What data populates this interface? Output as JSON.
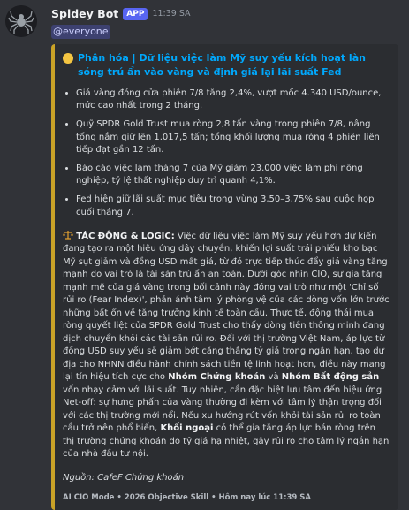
{
  "message": {
    "bot_name": "Spidey Bot",
    "badge": "APP",
    "timestamp": "11:39 SA",
    "mention": "@everyone"
  },
  "colors": {
    "embed_bar": "#c9a227",
    "title": "#00a8fc",
    "mention_bg": "#5865f2"
  },
  "embed": {
    "title_icon": "yellow-circle-icon",
    "title": "Phân hóa | Dữ liệu việc làm Mỹ suy yếu kích hoạt làn sóng trú ẩn vào vàng và định giá lại lãi suất Fed",
    "bullets": [
      "Giá vàng đóng cửa phiên 7/8 tăng 2,4%, vượt mốc 4.340 USD/ounce, mức cao nhất trong 2 tháng.",
      "Quỹ SPDR Gold Trust mua ròng 2,8 tấn vàng trong phiên 7/8, nâng tổng nắm giữ lên 1.017,5 tấn; tổng khối lượng mua ròng 4 phiên liên tiếp đạt gần 12 tấn.",
      "Báo cáo việc làm tháng 7 của Mỹ giảm 23.000 việc làm phi nông nghiệp, tỷ lệ thất nghiệp duy trì quanh 4,1%.",
      "Fed hiện giữ lãi suất mục tiêu trong vùng 3,50–3,75% sau cuộc họp cuối tháng 7."
    ],
    "impact": {
      "icon": "balance-scale-icon",
      "label": "TÁC ĐỘNG & LOGIC:",
      "p1": " Việc dữ liệu việc làm Mỹ suy yếu hơn dự kiến đang tạo ra một hiệu ứng dây chuyền, khiến lợi suất trái phiếu kho bạc Mỹ sụt giảm và đồng USD mất giá, từ đó trực tiếp thúc đẩy giá vàng tăng mạnh do vai trò là tài sản trú ẩn an toàn. Dưới góc nhìn CIO, sự gia tăng mạnh mẽ của giá vàng trong bối cảnh này đóng vai trò như một 'Chỉ số rủi ro (Fear Index)', phản ánh tâm lý phòng vệ của các dòng vốn lớn trước những bất ổn về tăng trưởng kinh tế toàn cầu. Thực tế, động thái mua ròng quyết liệt của SPDR Gold Trust cho thấy dòng tiền thông minh đang dịch chuyển khỏi các tài sản rủi ro. Đối với thị trường Việt Nam, áp lực từ đồng USD suy yếu sẽ giảm bớt căng thẳng tỷ giá trong ngắn hạn, tạo dư địa cho NHNN điều hành chính sách tiền tệ linh hoạt hơn, điều này mang lại tín hiệu tích cực cho ",
      "b1": "Nhóm Chứng khoán",
      "p2": " và ",
      "b2": "Nhóm Bất động sản",
      "p3": " vốn nhạy cảm với lãi suất. Tuy nhiên, cần đặc biệt lưu tâm đến hiệu ứng Net-off: sự hưng phấn của vàng thường đi kèm với tâm lý thận trọng đối với các thị trường mới nổi. Nếu xu hướng rút vốn khỏi tài sản rủi ro toàn cầu trở nên phổ biến, ",
      "b3": "Khối ngoại",
      "p4": " có thể gia tăng áp lực bán ròng trên thị trường chứng khoán do tỷ giá hạ nhiệt, gây rủi ro cho tâm lý ngắn hạn của nhà đầu tư nội."
    },
    "source": "Nguồn: CafeF Chứng khoán",
    "footer": "AI CIO Mode • 2026 Objective Skill • Hôm nay lúc 11:39 SA"
  }
}
